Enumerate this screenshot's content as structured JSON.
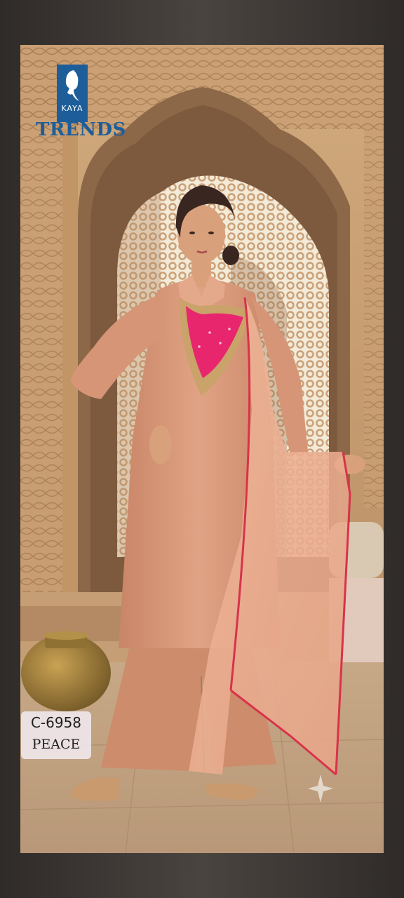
{
  "brand": {
    "small_name": "KAYA",
    "name": "TRENDS",
    "color": "#1d5e9a"
  },
  "product": {
    "code": "C-6958",
    "name": "PEACE"
  },
  "colors": {
    "kurta": "#d99a7a",
    "yoke": "#e8266e",
    "dupatta_border": "#d8334a",
    "palazzo": "#cd8c6c",
    "stone": "#c49a6c"
  },
  "icons": [
    "face-silhouette-icon",
    "sparkle-icon"
  ]
}
